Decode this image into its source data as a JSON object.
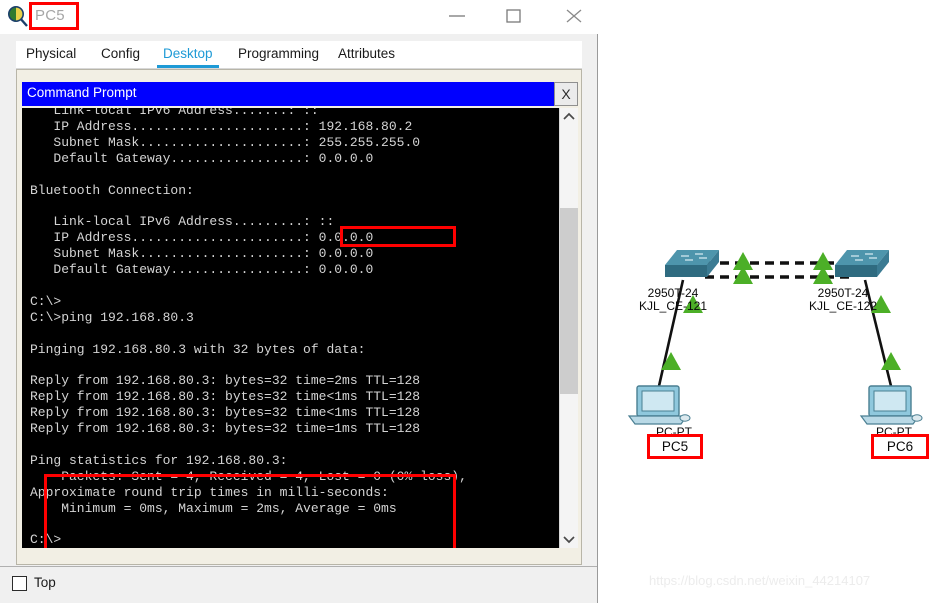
{
  "window": {
    "title": "PC5",
    "icon": "packet-tracer-icon",
    "controls": {
      "minimize": "minimize-icon",
      "maximize": "maximize-icon",
      "close": "close-icon"
    }
  },
  "tabs": [
    {
      "label": "Physical",
      "active": false
    },
    {
      "label": "Config",
      "active": false
    },
    {
      "label": "Desktop",
      "active": true
    },
    {
      "label": "Programming",
      "active": false
    },
    {
      "label": "Attributes",
      "active": false
    }
  ],
  "command_prompt": {
    "title": "Command Prompt",
    "close_label": "X",
    "terminal_text": "   Link-local IPv6 Address.......: ::\n   IP Address......................: 192.168.80.2\n   Subnet Mask.....................: 255.255.255.0\n   Default Gateway.................: 0.0.0.0\n\nBluetooth Connection:\n\n   Link-local IPv6 Address.........: ::\n   IP Address......................: 0.0.0.0\n   Subnet Mask.....................: 0.0.0.0\n   Default Gateway.................: 0.0.0.0\n\nC:\\>\nC:\\>ping 192.168.80.3\n\nPinging 192.168.80.3 with 32 bytes of data:\n\nReply from 192.168.80.3: bytes=32 time=2ms TTL=128\nReply from 192.168.80.3: bytes=32 time<1ms TTL=128\nReply from 192.168.80.3: bytes=32 time<1ms TTL=128\nReply from 192.168.80.3: bytes=32 time=1ms TTL=128\n\nPing statistics for 192.168.80.3:\n    Packets: Sent = 4, Received = 4, Lost = 0 (0% loss),\nApproximate round trip times in milli-seconds:\n    Minimum = 0ms, Maximum = 2ms, Average = 0ms\n\nC:\\>",
    "highlighted_ip": "192.168.80.2",
    "ping_target": "192.168.80.3",
    "replies": [
      "Reply from 192.168.80.3: bytes=32 time=2ms TTL=128",
      "Reply from 192.168.80.3: bytes=32 time<1ms TTL=128",
      "Reply from 192.168.80.3: bytes=32 time<1ms TTL=128",
      "Reply from 192.168.80.3: bytes=32 time=1ms TTL=128"
    ],
    "statistics": {
      "sent": "4",
      "received": "4",
      "lost": "0",
      "loss_percent": "0%",
      "minimum": "0ms",
      "maximum": "2ms",
      "average": "0ms"
    },
    "scrollbar": {
      "up_arrow": "chevron-up-icon",
      "down_arrow": "chevron-down-icon"
    }
  },
  "bottom_bar": {
    "checkbox_label": "Top",
    "checked": false
  },
  "topology": {
    "switch_left": {
      "model": "2950T-24",
      "name": "KJL_CE-121"
    },
    "switch_right": {
      "model": "2950T-24",
      "name": "KJL_CE-122"
    },
    "pc_left": {
      "model": "PC-PT",
      "name": "PC5"
    },
    "pc_right": {
      "model": "PC-PT",
      "name": "PC6"
    },
    "links": {
      "trunk_count": 2,
      "link_style": "dashed",
      "status_color": "#4caf27"
    }
  },
  "watermark": "https://blog.csdn.net/weixin_44214107",
  "colors": {
    "accent": "#1e9ad6",
    "annotation": "#ff0000",
    "cmd_titlebar": "#0000ff",
    "terminal_bg": "#000000",
    "link_up": "#4caf27"
  }
}
